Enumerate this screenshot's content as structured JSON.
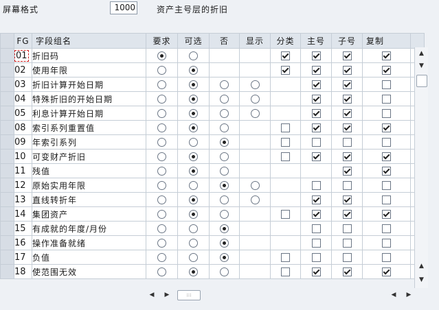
{
  "header": {
    "screen_format_label": "屏幕格式",
    "screen_format_value": "1000",
    "screen_format_desc": "资产主号层的折旧"
  },
  "table": {
    "columns": [
      "FG",
      "字段组名",
      "要求",
      "可选",
      "否",
      "显示",
      "分类",
      "主号",
      "子号",
      "复制"
    ],
    "rows": [
      {
        "fg": "01",
        "name": "折旧码",
        "req": true,
        "opt": false,
        "no": null,
        "disp": null,
        "cls": true,
        "main": true,
        "sub": true,
        "copy": true
      },
      {
        "fg": "02",
        "name": "使用年限",
        "req": false,
        "opt": true,
        "no": null,
        "disp": null,
        "cls": true,
        "main": true,
        "sub": true,
        "copy": true
      },
      {
        "fg": "03",
        "name": "折旧计算开始日期",
        "req": false,
        "opt": true,
        "no": false,
        "disp": false,
        "cls": null,
        "main": true,
        "sub": true,
        "copy": false
      },
      {
        "fg": "04",
        "name": "特殊折旧的开始日期",
        "req": false,
        "opt": true,
        "no": false,
        "disp": false,
        "cls": null,
        "main": true,
        "sub": true,
        "copy": false
      },
      {
        "fg": "05",
        "name": "利息计算开始日期",
        "req": false,
        "opt": true,
        "no": false,
        "disp": false,
        "cls": null,
        "main": true,
        "sub": true,
        "copy": false
      },
      {
        "fg": "08",
        "name": "索引系列重置值",
        "req": false,
        "opt": true,
        "no": false,
        "disp": null,
        "cls": false,
        "main": true,
        "sub": true,
        "copy": true
      },
      {
        "fg": "09",
        "name": "年索引系列",
        "req": false,
        "opt": false,
        "no": true,
        "disp": null,
        "cls": false,
        "main": false,
        "sub": false,
        "copy": false
      },
      {
        "fg": "10",
        "name": "可变财产折旧",
        "req": false,
        "opt": true,
        "no": false,
        "disp": null,
        "cls": false,
        "main": true,
        "sub": true,
        "copy": true
      },
      {
        "fg": "11",
        "name": "残值",
        "req": false,
        "opt": true,
        "no": false,
        "disp": null,
        "cls": null,
        "main": null,
        "sub": true,
        "copy": true
      },
      {
        "fg": "12",
        "name": "原始实用年限",
        "req": false,
        "opt": false,
        "no": true,
        "disp": false,
        "cls": null,
        "main": false,
        "sub": false,
        "copy": false
      },
      {
        "fg": "13",
        "name": "直线转折年",
        "req": false,
        "opt": true,
        "no": false,
        "disp": false,
        "cls": null,
        "main": true,
        "sub": true,
        "copy": false
      },
      {
        "fg": "14",
        "name": "集团资产",
        "req": false,
        "opt": true,
        "no": false,
        "disp": null,
        "cls": false,
        "main": true,
        "sub": true,
        "copy": true
      },
      {
        "fg": "15",
        "name": "有成就的年度/月份",
        "req": false,
        "opt": false,
        "no": true,
        "disp": null,
        "cls": null,
        "main": false,
        "sub": false,
        "copy": false
      },
      {
        "fg": "16",
        "name": "操作准备就绪",
        "req": false,
        "opt": false,
        "no": true,
        "disp": null,
        "cls": null,
        "main": false,
        "sub": false,
        "copy": false
      },
      {
        "fg": "17",
        "name": "负值",
        "req": false,
        "opt": false,
        "no": true,
        "disp": null,
        "cls": false,
        "main": false,
        "sub": false,
        "copy": false
      },
      {
        "fg": "18",
        "name": "使范围无效",
        "req": false,
        "opt": true,
        "no": false,
        "disp": null,
        "cls": false,
        "main": true,
        "sub": true,
        "copy": true
      }
    ]
  },
  "icons": {
    "scroll_up": "scroll-up-icon",
    "scroll_down": "scroll-down-icon",
    "scroll_left": "scroll-left-icon",
    "scroll_right": "scroll-right-icon"
  },
  "colors": {
    "header_bg": "#dfe5ec",
    "grid_line": "#c5cdd6",
    "focus_border": "#d02020"
  }
}
